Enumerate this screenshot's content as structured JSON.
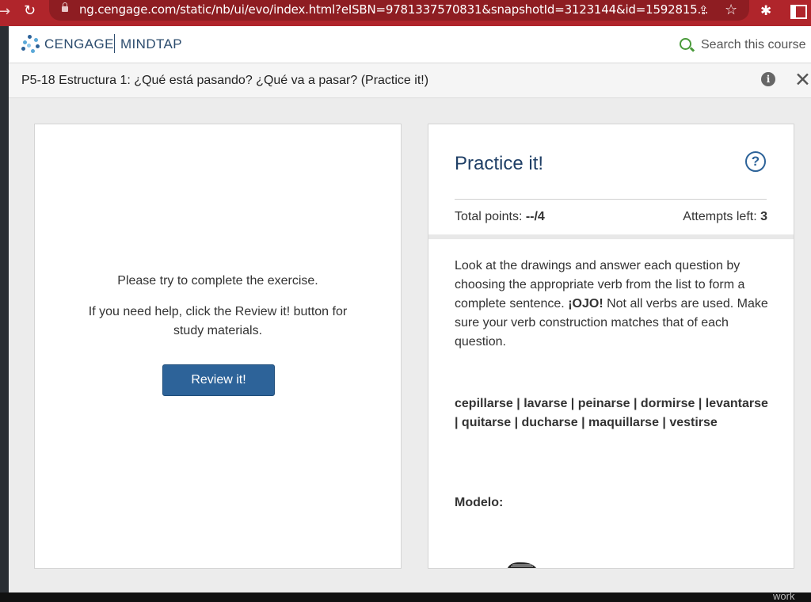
{
  "browser": {
    "url": "ng.cengage.com/static/nb/ui/evo/index.html?eISBN=9781337570831&snapshotId=3123144&id=1592815...",
    "back_icon": "arrow-right-icon",
    "reload_icon": "reload-icon"
  },
  "header": {
    "brand_cengage": "CENGAGE",
    "brand_mindtap": "MINDTAP",
    "search_label": "Search this course"
  },
  "title_bar": {
    "title": "P5-18 Estructura 1: ¿Qué está pasando? ¿Qué va a pasar? (Practice it!)"
  },
  "left_panel": {
    "message1": "Please try to complete the exercise.",
    "message2": "If you need help, click the Review it! button for study materials.",
    "review_button": "Review it!"
  },
  "right_panel": {
    "title": "Practice it!",
    "help_symbol": "?",
    "total_points_label": "Total points: ",
    "total_points_value": "--/4",
    "attempts_label": "Attempts left: ",
    "attempts_value": "3",
    "instructions_before": "Look at the drawings and answer each question by choosing the appropriate verb from the list to form a complete sentence. ",
    "ojo": "¡OJO!",
    "instructions_after": " Not all verbs are used. Make sure your verb construction matches that of each question.",
    "verb_list": "cepillarse | lavarse | peinarse | dormirse | levantarse | quitarse | ducharse | maquillarse | vestirse",
    "modelo": "Modelo:"
  },
  "footer": {
    "corner_text": "work"
  },
  "colors": {
    "browser_red": "#b0252b",
    "brand_blue": "#2c4c6e",
    "button_blue": "#2d6399",
    "search_green": "#4a9a3a"
  }
}
